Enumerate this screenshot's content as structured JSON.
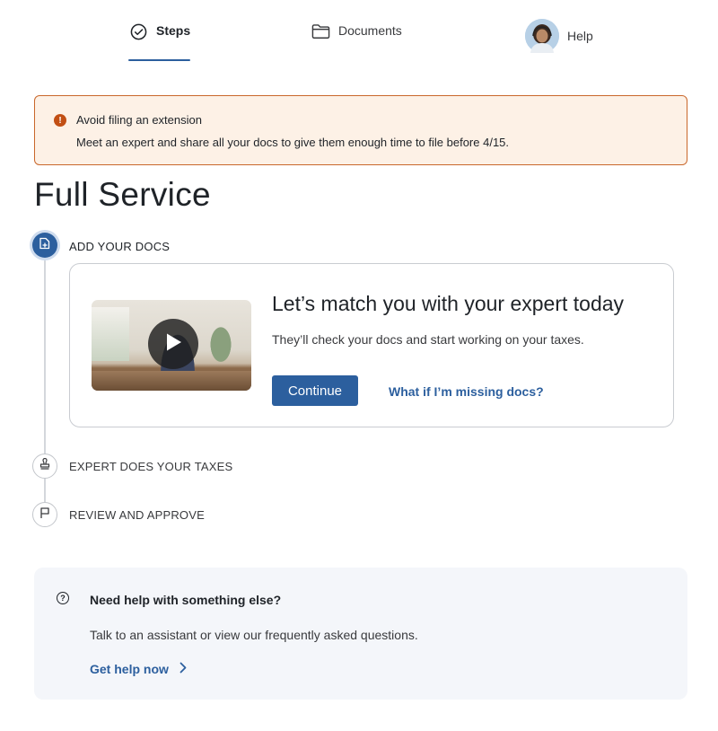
{
  "nav": {
    "tabs": [
      {
        "label": "Steps",
        "icon": "check-circle-icon",
        "active": true
      },
      {
        "label": "Documents",
        "icon": "folder-icon",
        "active": false
      },
      {
        "label": "Help",
        "icon": "avatar",
        "active": false
      }
    ]
  },
  "alert": {
    "title": "Avoid filing an extension",
    "body": "Meet an expert and share all your docs to give them enough time to file before 4/15.",
    "icon_glyph": "!"
  },
  "page": {
    "title": "Full Service"
  },
  "steps": [
    {
      "label": "ADD YOUR DOCS",
      "icon": "upload-doc-icon",
      "status": "active"
    },
    {
      "label": "EXPERT DOES YOUR TAXES",
      "icon": "stamp-icon",
      "status": "pending"
    },
    {
      "label": "REVIEW AND APPROVE",
      "icon": "flag-icon",
      "status": "pending"
    }
  ],
  "card": {
    "title": "Let’s match you with your expert today",
    "body": "They’ll check your docs and start working on your taxes.",
    "continue_label": "Continue",
    "missing_link": "What if I’m missing docs?"
  },
  "help": {
    "icon_glyph": "?",
    "title": "Need help with something else?",
    "body": "Talk to an assistant or view our frequently asked questions.",
    "link": "Get help now"
  },
  "colors": {
    "accent": "#2c5f9e",
    "alert_bg": "#fdf1e6",
    "alert_border": "#c9672b",
    "alert_icon": "#c24f14",
    "help_bg": "#f4f6fa"
  }
}
